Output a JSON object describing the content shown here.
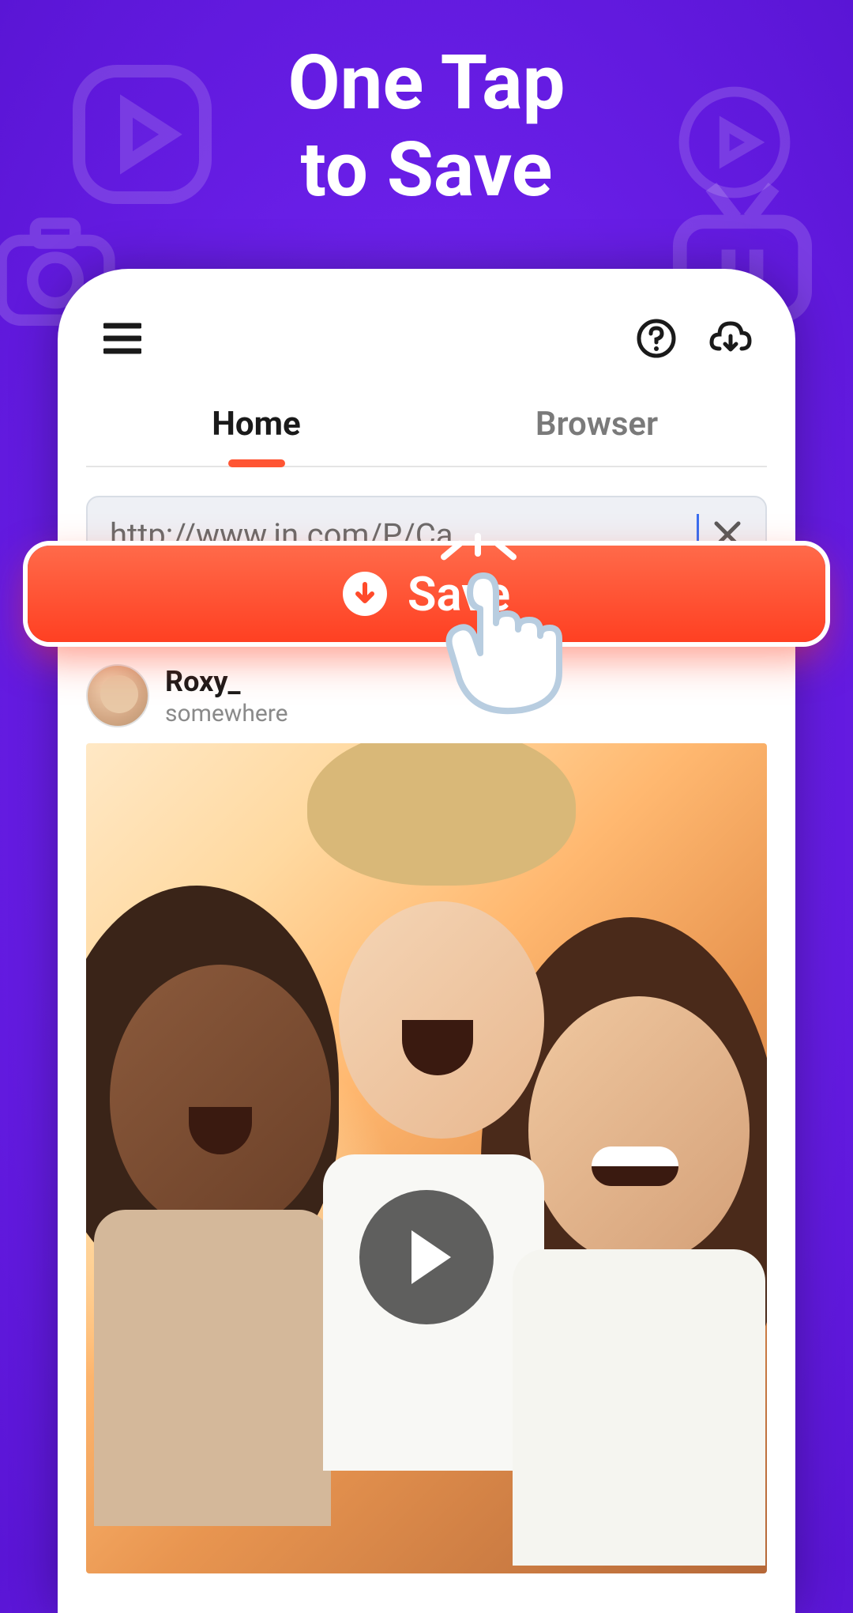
{
  "headline": {
    "line1": "One Tap",
    "line2": "to Save"
  },
  "topbar": {
    "menu_icon": "menu",
    "help_icon": "help",
    "download_icon": "cloud-download"
  },
  "tabs": {
    "home": "Home",
    "browser": "Browser"
  },
  "url_bar": {
    "value": "http://www.in.com/P/Ca...",
    "clear_icon": "close"
  },
  "save_button": {
    "label": "Save",
    "icon": "download-circle"
  },
  "post": {
    "username": "Roxy_",
    "location": "somewhere",
    "play_icon": "play"
  }
}
